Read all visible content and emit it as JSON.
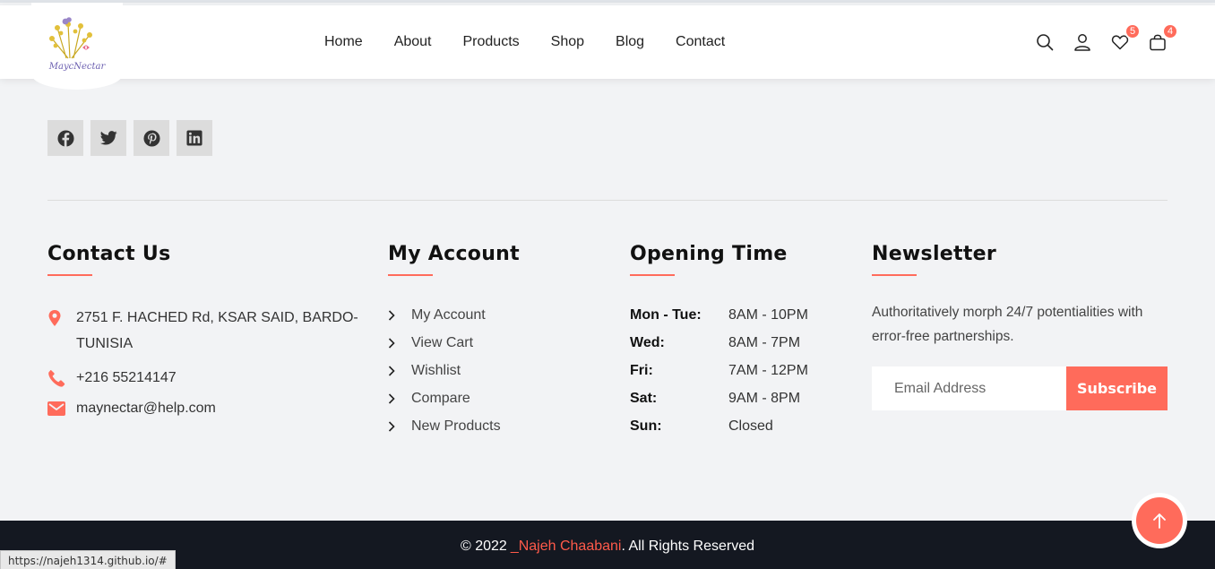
{
  "logo": {
    "text": "MaycNectar"
  },
  "nav": [
    "Home",
    "About",
    "Products",
    "Shop",
    "Blog",
    "Contact"
  ],
  "header_icons": {
    "wishlist_count": "5",
    "cart_count": "4"
  },
  "social": [
    "facebook-icon",
    "twitter-icon",
    "pinterest-icon",
    "linkedin-icon"
  ],
  "contact": {
    "title": "Contact Us",
    "address_line1": "2751 F. HACHED Rd, KSAR SAID, BARDO-",
    "address_line2": "TUNISIA",
    "phone": "+216 55214147",
    "email": "maynectar@help.com"
  },
  "account": {
    "title": "My Account",
    "items": [
      "My Account",
      "View Cart",
      "Wishlist",
      "Compare",
      "New Products"
    ]
  },
  "hours": {
    "title": "Opening Time",
    "rows": [
      {
        "day": "Mon - Tue:",
        "time": "8AM - 10PM"
      },
      {
        "day": "Wed:",
        "time": "8AM - 7PM"
      },
      {
        "day": "Fri:",
        "time": "7AM - 12PM"
      },
      {
        "day": "Sat:",
        "time": "9AM - 8PM"
      },
      {
        "day": "Sun:",
        "time": "Closed"
      }
    ]
  },
  "newsletter": {
    "title": "Newsletter",
    "text": "Authoritatively morph 24/7 potentialities with error-free partnerships.",
    "placeholder": "Email Address",
    "button": "Subscribe"
  },
  "footer": {
    "prefix": "© 2022 ",
    "author": "_Najeh Chaabani",
    "suffix": ". All Rights Reserved"
  },
  "status_url": "https://najeh1314.github.io/#",
  "colors": {
    "accent": "#ff6b5b",
    "footer_bg": "#141821"
  }
}
